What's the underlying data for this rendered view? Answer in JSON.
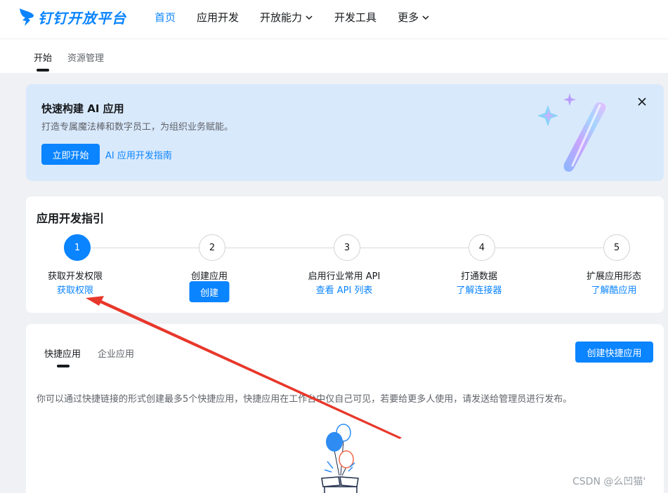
{
  "header": {
    "logo_text": "钉钉开放平台",
    "nav": [
      {
        "label": "首页",
        "active": true
      },
      {
        "label": "应用开发"
      },
      {
        "label": "开放能力",
        "dropdown": true
      },
      {
        "label": "开发工具"
      },
      {
        "label": "更多",
        "dropdown": true
      }
    ]
  },
  "subnav": {
    "tabs": [
      "开始",
      "资源管理"
    ],
    "active": "开始"
  },
  "banner": {
    "title": "快速构建 AI 应用",
    "subtitle": "打造专属魔法棒和数字员工，为组织业务赋能。",
    "button_label": "立即开始",
    "link_label": "AI 应用开发指南"
  },
  "guide": {
    "title": "应用开发指引",
    "steps": [
      {
        "num": "1",
        "label": "获取开发权限",
        "action": "获取权限",
        "active": true
      },
      {
        "num": "2",
        "label": "创建应用",
        "action": "创建",
        "action_type": "button"
      },
      {
        "num": "3",
        "label": "启用行业常用 API",
        "action": "查看 API 列表"
      },
      {
        "num": "4",
        "label": "打通数据",
        "action": "了解连接器"
      },
      {
        "num": "5",
        "label": "扩展应用形态",
        "action": "了解酷应用"
      }
    ]
  },
  "quick": {
    "tabs": [
      "快捷应用",
      "企业应用"
    ],
    "active": "快捷应用",
    "create_button": "创建快捷应用",
    "description": "你可以通过快捷链接的形式创建最多5个快捷应用，快捷应用在工作台中仅自己可见，若要给更多人使用，请发送给管理员进行发布。"
  },
  "watermark": "CSDN @么凹猫'",
  "colors": {
    "accent": "#0a84ff",
    "banner_bg": "#d9e9fc",
    "annotation_arrow": "#e8372b"
  }
}
